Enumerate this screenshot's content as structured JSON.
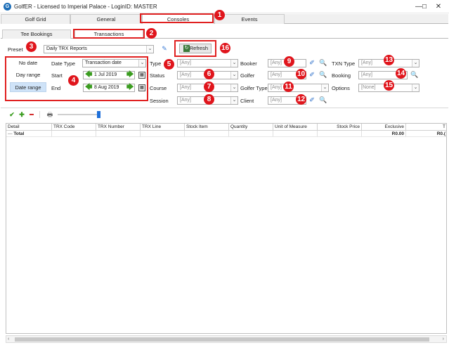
{
  "window": {
    "title": "GolfER - Licensed to Imperial Palace - LoginID: MASTER",
    "minimize": "—",
    "maximize": "☐",
    "close": "✕"
  },
  "tabs": [
    "Golf Grid",
    "General",
    "Consoles",
    "Events"
  ],
  "subtabs": [
    "Tee Bookings",
    "Transactions"
  ],
  "preset": {
    "label": "Preset",
    "value": "Daily TRX Reports"
  },
  "refresh_label": "Refresh",
  "date_modes": [
    "No date",
    "Day range",
    "Date range"
  ],
  "date_type": {
    "label": "Date Type",
    "value": "Transaction date"
  },
  "start": {
    "label": "Start",
    "value": "1 Jul 2019"
  },
  "end": {
    "label": "End",
    "value": "8 Aug 2019"
  },
  "filters_col1": [
    {
      "label": "Type",
      "value": "[Any]"
    },
    {
      "label": "Status",
      "value": "[Any]"
    },
    {
      "label": "Course",
      "value": "[Any]"
    },
    {
      "label": "Session",
      "value": "[Any]"
    }
  ],
  "filters_col2": [
    {
      "label": "Booker",
      "value": "[Any]"
    },
    {
      "label": "Golfer",
      "value": "[Any]"
    },
    {
      "label": "Golfer Type",
      "value": "[Any]"
    },
    {
      "label": "Client",
      "value": "[Any]"
    }
  ],
  "filters_col3": [
    {
      "label": "TXN Type",
      "value": "[Any]"
    },
    {
      "label": "Booking",
      "value": "[Any]"
    },
    {
      "label": "Options",
      "value": "[None]"
    }
  ],
  "badges": [
    "1",
    "2",
    "3",
    "4",
    "5",
    "6",
    "7",
    "8",
    "9",
    "10",
    "11",
    "12",
    "13",
    "14",
    "15",
    "16"
  ],
  "toolbar_icons": {
    "check": "✔",
    "add": "✚",
    "remove": "━",
    "print": "🖶"
  },
  "grid": {
    "columns": [
      "Detail",
      "TRX Code",
      "TRX Number",
      "TRX Line",
      "Stock Item",
      "Quantity",
      "Unit of Measure",
      "Stock Price",
      "Exclusive",
      "T"
    ],
    "total_row": {
      "label": "Total",
      "exclusive": "R0.00",
      "t": "R0.("
    }
  }
}
